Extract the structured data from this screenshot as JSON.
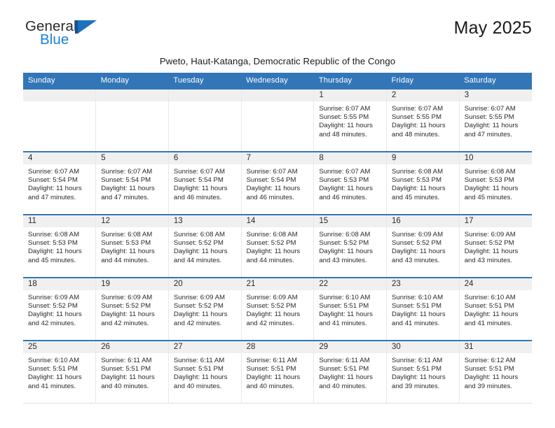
{
  "logo": {
    "text_general": "General",
    "text_blue": "Blue",
    "mark": "triangle-flag-icon"
  },
  "header": {
    "title": "May 2025",
    "subtitle": "Pweto, Haut-Katanga, Democratic Republic of the Congo"
  },
  "calendar": {
    "weekday_headers": [
      "Sunday",
      "Monday",
      "Tuesday",
      "Wednesday",
      "Thursday",
      "Friday",
      "Saturday"
    ],
    "accent_color": "#3376b8",
    "daynum_background": "#f0f0f0",
    "weeks": [
      [
        {
          "day": "",
          "sunrise": "",
          "sunset": "",
          "daylight_line1": "",
          "daylight_line2": ""
        },
        {
          "day": "",
          "sunrise": "",
          "sunset": "",
          "daylight_line1": "",
          "daylight_line2": ""
        },
        {
          "day": "",
          "sunrise": "",
          "sunset": "",
          "daylight_line1": "",
          "daylight_line2": ""
        },
        {
          "day": "",
          "sunrise": "",
          "sunset": "",
          "daylight_line1": "",
          "daylight_line2": ""
        },
        {
          "day": "1",
          "sunrise": "Sunrise: 6:07 AM",
          "sunset": "Sunset: 5:55 PM",
          "daylight_line1": "Daylight: 11 hours",
          "daylight_line2": "and 48 minutes."
        },
        {
          "day": "2",
          "sunrise": "Sunrise: 6:07 AM",
          "sunset": "Sunset: 5:55 PM",
          "daylight_line1": "Daylight: 11 hours",
          "daylight_line2": "and 48 minutes."
        },
        {
          "day": "3",
          "sunrise": "Sunrise: 6:07 AM",
          "sunset": "Sunset: 5:55 PM",
          "daylight_line1": "Daylight: 11 hours",
          "daylight_line2": "and 47 minutes."
        }
      ],
      [
        {
          "day": "4",
          "sunrise": "Sunrise: 6:07 AM",
          "sunset": "Sunset: 5:54 PM",
          "daylight_line1": "Daylight: 11 hours",
          "daylight_line2": "and 47 minutes."
        },
        {
          "day": "5",
          "sunrise": "Sunrise: 6:07 AM",
          "sunset": "Sunset: 5:54 PM",
          "daylight_line1": "Daylight: 11 hours",
          "daylight_line2": "and 47 minutes."
        },
        {
          "day": "6",
          "sunrise": "Sunrise: 6:07 AM",
          "sunset": "Sunset: 5:54 PM",
          "daylight_line1": "Daylight: 11 hours",
          "daylight_line2": "and 46 minutes."
        },
        {
          "day": "7",
          "sunrise": "Sunrise: 6:07 AM",
          "sunset": "Sunset: 5:54 PM",
          "daylight_line1": "Daylight: 11 hours",
          "daylight_line2": "and 46 minutes."
        },
        {
          "day": "8",
          "sunrise": "Sunrise: 6:07 AM",
          "sunset": "Sunset: 5:53 PM",
          "daylight_line1": "Daylight: 11 hours",
          "daylight_line2": "and 46 minutes."
        },
        {
          "day": "9",
          "sunrise": "Sunrise: 6:08 AM",
          "sunset": "Sunset: 5:53 PM",
          "daylight_line1": "Daylight: 11 hours",
          "daylight_line2": "and 45 minutes."
        },
        {
          "day": "10",
          "sunrise": "Sunrise: 6:08 AM",
          "sunset": "Sunset: 5:53 PM",
          "daylight_line1": "Daylight: 11 hours",
          "daylight_line2": "and 45 minutes."
        }
      ],
      [
        {
          "day": "11",
          "sunrise": "Sunrise: 6:08 AM",
          "sunset": "Sunset: 5:53 PM",
          "daylight_line1": "Daylight: 11 hours",
          "daylight_line2": "and 45 minutes."
        },
        {
          "day": "12",
          "sunrise": "Sunrise: 6:08 AM",
          "sunset": "Sunset: 5:53 PM",
          "daylight_line1": "Daylight: 11 hours",
          "daylight_line2": "and 44 minutes."
        },
        {
          "day": "13",
          "sunrise": "Sunrise: 6:08 AM",
          "sunset": "Sunset: 5:52 PM",
          "daylight_line1": "Daylight: 11 hours",
          "daylight_line2": "and 44 minutes."
        },
        {
          "day": "14",
          "sunrise": "Sunrise: 6:08 AM",
          "sunset": "Sunset: 5:52 PM",
          "daylight_line1": "Daylight: 11 hours",
          "daylight_line2": "and 44 minutes."
        },
        {
          "day": "15",
          "sunrise": "Sunrise: 6:08 AM",
          "sunset": "Sunset: 5:52 PM",
          "daylight_line1": "Daylight: 11 hours",
          "daylight_line2": "and 43 minutes."
        },
        {
          "day": "16",
          "sunrise": "Sunrise: 6:09 AM",
          "sunset": "Sunset: 5:52 PM",
          "daylight_line1": "Daylight: 11 hours",
          "daylight_line2": "and 43 minutes."
        },
        {
          "day": "17",
          "sunrise": "Sunrise: 6:09 AM",
          "sunset": "Sunset: 5:52 PM",
          "daylight_line1": "Daylight: 11 hours",
          "daylight_line2": "and 43 minutes."
        }
      ],
      [
        {
          "day": "18",
          "sunrise": "Sunrise: 6:09 AM",
          "sunset": "Sunset: 5:52 PM",
          "daylight_line1": "Daylight: 11 hours",
          "daylight_line2": "and 42 minutes."
        },
        {
          "day": "19",
          "sunrise": "Sunrise: 6:09 AM",
          "sunset": "Sunset: 5:52 PM",
          "daylight_line1": "Daylight: 11 hours",
          "daylight_line2": "and 42 minutes."
        },
        {
          "day": "20",
          "sunrise": "Sunrise: 6:09 AM",
          "sunset": "Sunset: 5:52 PM",
          "daylight_line1": "Daylight: 11 hours",
          "daylight_line2": "and 42 minutes."
        },
        {
          "day": "21",
          "sunrise": "Sunrise: 6:09 AM",
          "sunset": "Sunset: 5:52 PM",
          "daylight_line1": "Daylight: 11 hours",
          "daylight_line2": "and 42 minutes."
        },
        {
          "day": "22",
          "sunrise": "Sunrise: 6:10 AM",
          "sunset": "Sunset: 5:51 PM",
          "daylight_line1": "Daylight: 11 hours",
          "daylight_line2": "and 41 minutes."
        },
        {
          "day": "23",
          "sunrise": "Sunrise: 6:10 AM",
          "sunset": "Sunset: 5:51 PM",
          "daylight_line1": "Daylight: 11 hours",
          "daylight_line2": "and 41 minutes."
        },
        {
          "day": "24",
          "sunrise": "Sunrise: 6:10 AM",
          "sunset": "Sunset: 5:51 PM",
          "daylight_line1": "Daylight: 11 hours",
          "daylight_line2": "and 41 minutes."
        }
      ],
      [
        {
          "day": "25",
          "sunrise": "Sunrise: 6:10 AM",
          "sunset": "Sunset: 5:51 PM",
          "daylight_line1": "Daylight: 11 hours",
          "daylight_line2": "and 41 minutes."
        },
        {
          "day": "26",
          "sunrise": "Sunrise: 6:11 AM",
          "sunset": "Sunset: 5:51 PM",
          "daylight_line1": "Daylight: 11 hours",
          "daylight_line2": "and 40 minutes."
        },
        {
          "day": "27",
          "sunrise": "Sunrise: 6:11 AM",
          "sunset": "Sunset: 5:51 PM",
          "daylight_line1": "Daylight: 11 hours",
          "daylight_line2": "and 40 minutes."
        },
        {
          "day": "28",
          "sunrise": "Sunrise: 6:11 AM",
          "sunset": "Sunset: 5:51 PM",
          "daylight_line1": "Daylight: 11 hours",
          "daylight_line2": "and 40 minutes."
        },
        {
          "day": "29",
          "sunrise": "Sunrise: 6:11 AM",
          "sunset": "Sunset: 5:51 PM",
          "daylight_line1": "Daylight: 11 hours",
          "daylight_line2": "and 40 minutes."
        },
        {
          "day": "30",
          "sunrise": "Sunrise: 6:11 AM",
          "sunset": "Sunset: 5:51 PM",
          "daylight_line1": "Daylight: 11 hours",
          "daylight_line2": "and 39 minutes."
        },
        {
          "day": "31",
          "sunrise": "Sunrise: 6:12 AM",
          "sunset": "Sunset: 5:51 PM",
          "daylight_line1": "Daylight: 11 hours",
          "daylight_line2": "and 39 minutes."
        }
      ]
    ]
  }
}
